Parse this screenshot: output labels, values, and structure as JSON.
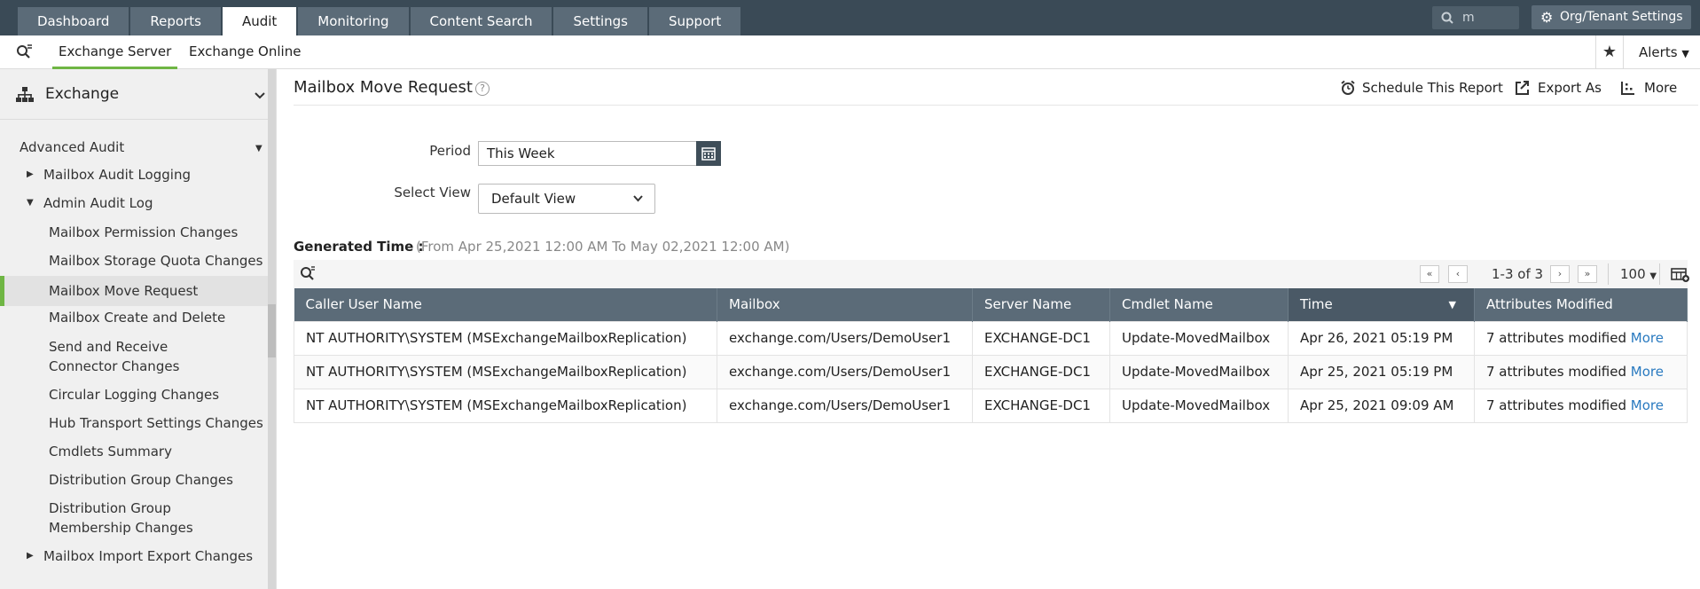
{
  "top_nav": {
    "tabs": [
      {
        "label": "Dashboard",
        "active": false
      },
      {
        "label": "Reports",
        "active": false
      },
      {
        "label": "Audit",
        "active": true
      },
      {
        "label": "Monitoring",
        "active": false
      },
      {
        "label": "Content Search",
        "active": false
      },
      {
        "label": "Settings",
        "active": false
      },
      {
        "label": "Support",
        "active": false
      }
    ],
    "search_value": "m",
    "org_settings_label": "Org/Tenant Settings"
  },
  "sub_nav": {
    "tabs": [
      {
        "label": "Exchange Server",
        "active": true
      },
      {
        "label": "Exchange Online",
        "active": false
      }
    ],
    "alerts_label": "Alerts"
  },
  "sidebar": {
    "section_title": "Exchange",
    "group_title": "Advanced Audit",
    "items": [
      {
        "label": "Mailbox Audit Logging",
        "level": 1,
        "expander": "collapsed"
      },
      {
        "label": "Admin Audit Log",
        "level": 1,
        "expander": "expanded"
      },
      {
        "label": "Mailbox Permission Changes",
        "level": 2
      },
      {
        "label": "Mailbox Storage Quota Changes",
        "level": 2
      },
      {
        "label": "Mailbox Move Request",
        "level": 2,
        "selected": true
      },
      {
        "label": "Mailbox Create and Delete",
        "level": 2
      },
      {
        "label": "Send and Receive Connector Changes",
        "level": 2
      },
      {
        "label": "Circular Logging Changes",
        "level": 2
      },
      {
        "label": "Hub Transport Settings Changes",
        "level": 2
      },
      {
        "label": "Cmdlets Summary",
        "level": 2
      },
      {
        "label": "Distribution Group Changes",
        "level": 2
      },
      {
        "label": "Distribution Group Membership Changes",
        "level": 2
      },
      {
        "label": "Mailbox Import Export Changes",
        "level": 1,
        "expander": "collapsed"
      }
    ]
  },
  "report": {
    "title": "Mailbox Move Request",
    "help_glyph": "?",
    "actions": {
      "schedule": "Schedule This Report",
      "export": "Export As",
      "more": "More"
    },
    "filters": {
      "period_label": "Period",
      "period_value": "This Week",
      "view_label": "Select View",
      "view_value": "Default View"
    },
    "generated_label": "Generated Time :",
    "generated_value": "(From Apr 25,2021 12:00 AM To May 02,2021 12:00 AM)",
    "pagination": {
      "range": "1-3 of 3",
      "page_size": "100"
    },
    "columns": [
      "Caller User Name",
      "Mailbox",
      "Server Name",
      "Cmdlet Name",
      "Time",
      "Attributes Modified"
    ],
    "rows": [
      {
        "caller": "NT AUTHORITY\\SYSTEM (MSExchangeMailboxReplication)",
        "mailbox": "exchange.com/Users/DemoUser1",
        "server": "EXCHANGE-DC1",
        "cmdlet": "Update-MovedMailbox",
        "time": "Apr 26, 2021 05:19 PM",
        "attributes": "7 attributes modified",
        "more": "More"
      },
      {
        "caller": "NT AUTHORITY\\SYSTEM (MSExchangeMailboxReplication)",
        "mailbox": "exchange.com/Users/DemoUser1",
        "server": "EXCHANGE-DC1",
        "cmdlet": "Update-MovedMailbox",
        "time": "Apr 25, 2021 05:19 PM",
        "attributes": "7 attributes modified",
        "more": "More"
      },
      {
        "caller": "NT AUTHORITY\\SYSTEM (MSExchangeMailboxReplication)",
        "mailbox": "exchange.com/Users/DemoUser1",
        "server": "EXCHANGE-DC1",
        "cmdlet": "Update-MovedMailbox",
        "time": "Apr 25, 2021 09:09 AM",
        "attributes": "7 attributes modified",
        "more": "More"
      }
    ]
  },
  "colors": {
    "nav_bg": "#3a4a56",
    "tab_bg": "#5b6b78",
    "accent_green": "#6fb644",
    "link_blue": "#2a7ac0"
  }
}
